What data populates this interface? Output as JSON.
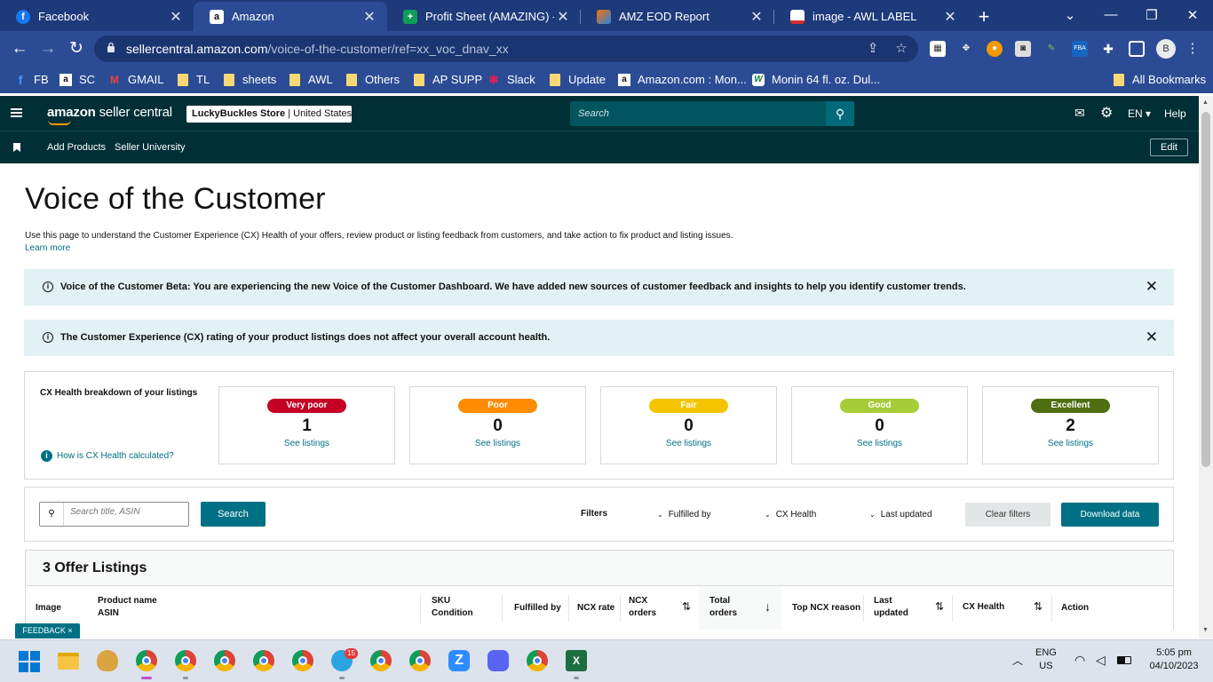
{
  "browser": {
    "tabs": [
      {
        "title": "Facebook",
        "favicon": "f",
        "color": "#1877f2"
      },
      {
        "title": "Amazon",
        "favicon": "a",
        "color": "#ffffff"
      },
      {
        "title": "Profit Sheet (AMAZING) - Go",
        "favicon": "+",
        "color": "#0f9d58"
      },
      {
        "title": "AMZ EOD Report",
        "favicon": "",
        "color": "#ff6d00"
      },
      {
        "title": "image - AWL LABEL",
        "favicon": "",
        "color": "#d32f2f"
      }
    ],
    "active_tab": 1,
    "url_host": "sellercentral.amazon.com",
    "url_path": "/voice-of-the-customer/ref=xx_voc_dnav_xx",
    "profile_initial": "B",
    "bookmarks": [
      {
        "label": "FB",
        "type": "fb"
      },
      {
        "label": "SC",
        "type": "amazon"
      },
      {
        "label": "GMAIL",
        "type": "gmail"
      },
      {
        "label": "TL",
        "type": "folder"
      },
      {
        "label": "sheets",
        "type": "folder"
      },
      {
        "label": "AWL",
        "type": "folder"
      },
      {
        "label": "Others",
        "type": "folder"
      },
      {
        "label": "AP SUPP",
        "type": "folder"
      },
      {
        "label": "Slack",
        "type": "slack"
      },
      {
        "label": "Update",
        "type": "folder"
      },
      {
        "label": "Amazon.com : Mon...",
        "type": "amazon"
      },
      {
        "label": "Monin 64 fl. oz. Dul...",
        "type": "monin"
      }
    ],
    "all_bookmarks": "All Bookmarks"
  },
  "header": {
    "logo_a": "amazon",
    "logo_b": "seller central",
    "store_name": "LuckyBuckles Store",
    "marketplace": "United States",
    "search_placeholder": "Search",
    "lang": "EN",
    "help": "Help",
    "nav": [
      "Add Products",
      "Seller University"
    ],
    "edit": "Edit"
  },
  "page": {
    "title": "Voice of the Customer",
    "description": "Use this page to understand the Customer Experience (CX) Health of your offers, review product or listing feedback from customers, and take action to fix product and listing issues.",
    "learn_more": "Learn more",
    "banners": [
      "Voice of the Customer Beta: You are experiencing the new Voice of the Customer Dashboard. We have added new sources of customer feedback and insights to help you identify customer trends.",
      "The Customer Experience (CX) rating of your product listings does not affect your overall account health."
    ],
    "cx_label": "CX Health breakdown of your listings",
    "how_cx": "How is CX Health calculated?",
    "health": [
      {
        "label": "Very poor",
        "count": "1",
        "color": "#c40025",
        "link": "See listings"
      },
      {
        "label": "Poor",
        "count": "0",
        "color": "#fe8b00",
        "link": "See listings"
      },
      {
        "label": "Fair",
        "count": "0",
        "color": "#f5c400",
        "link": "See listings"
      },
      {
        "label": "Good",
        "count": "0",
        "color": "#a6cc38",
        "link": "See listings"
      },
      {
        "label": "Excellent",
        "count": "2",
        "color": "#4e6e10",
        "link": "See listings"
      }
    ],
    "search_placeholder": "Search title, ASIN",
    "search_button": "Search",
    "filters_label": "Filters",
    "filters": [
      "Fulfilled by",
      "CX Health",
      "Last updated"
    ],
    "clear_filters": "Clear filters",
    "download": "Download data",
    "offers_title": "3 Offer Listings",
    "columns": {
      "image": "Image",
      "product": "Product name",
      "asin": "ASIN",
      "sku": "SKU",
      "condition": "Condition",
      "fulfilled": "Fulfilled by",
      "ncx_rate": "NCX rate",
      "ncx_orders_1": "NCX",
      "ncx_orders_2": "orders",
      "total_orders_1": "Total",
      "total_orders_2": "orders",
      "top_reason": "Top NCX reason",
      "last_updated_1": "Last",
      "last_updated_2": "updated",
      "cx_health": "CX Health",
      "action": "Action"
    },
    "feedback": "FEEDBACK ×"
  },
  "taskbar": {
    "lang_1": "ENG",
    "lang_2": "US",
    "time": "5:05 pm",
    "date": "04/10/2023",
    "telegram_badge": "15"
  }
}
